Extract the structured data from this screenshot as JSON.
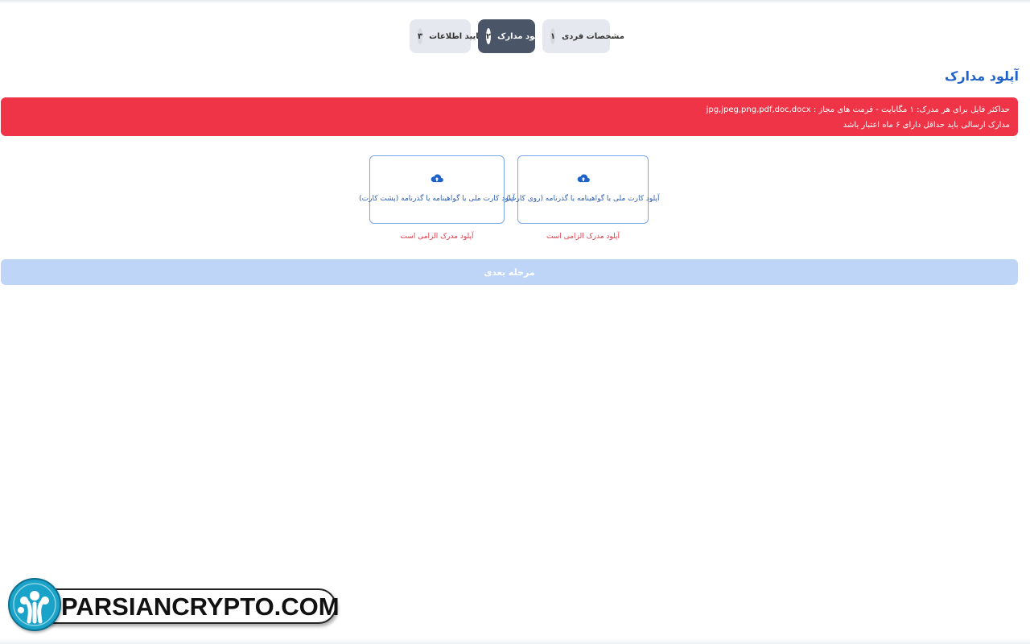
{
  "stepper": {
    "steps": [
      {
        "number": "۱",
        "label": "مشخصات فردی",
        "state": "inactive"
      },
      {
        "number": "۲",
        "label": "آپلود مدارک",
        "state": "active"
      },
      {
        "number": "۳",
        "label": "تایید اطلاعات",
        "state": "inactive"
      }
    ]
  },
  "section": {
    "title": "آپلود مدارک"
  },
  "alert": {
    "line1": "حداکثر فایل برای هر مدرک: ۱ مگابایت - فرمت های مجاز : jpg,jpeg,png,pdf,doc,docx",
    "line2": "مدارک ارسالی باید حداقل دارای ۶ ماه اعتبار باشد"
  },
  "uploads": {
    "front": {
      "label": "آپلود کارت ملی یا گواهینامه یا گذرنامه (روی کارت)",
      "required_message": "آپلود مدرک الزامی است",
      "icon": "cloud-upload-icon"
    },
    "back": {
      "label": "آپلود کارت ملی یا گواهینامه یا گذرنامه (پشت کارت)",
      "required_message": "آپلود مدرک الزامی است",
      "icon": "cloud-upload-icon"
    }
  },
  "actions": {
    "next_label": "مرحله بعدی"
  },
  "watermark": {
    "text": "PARSIANCRYPTO.COM"
  },
  "colors": {
    "accent": "#1f63c8",
    "alert_bg": "#ee3446",
    "active_step": "#4a5568",
    "next_button_disabled": "#bfd5f7",
    "error_text": "#e23b4a"
  }
}
